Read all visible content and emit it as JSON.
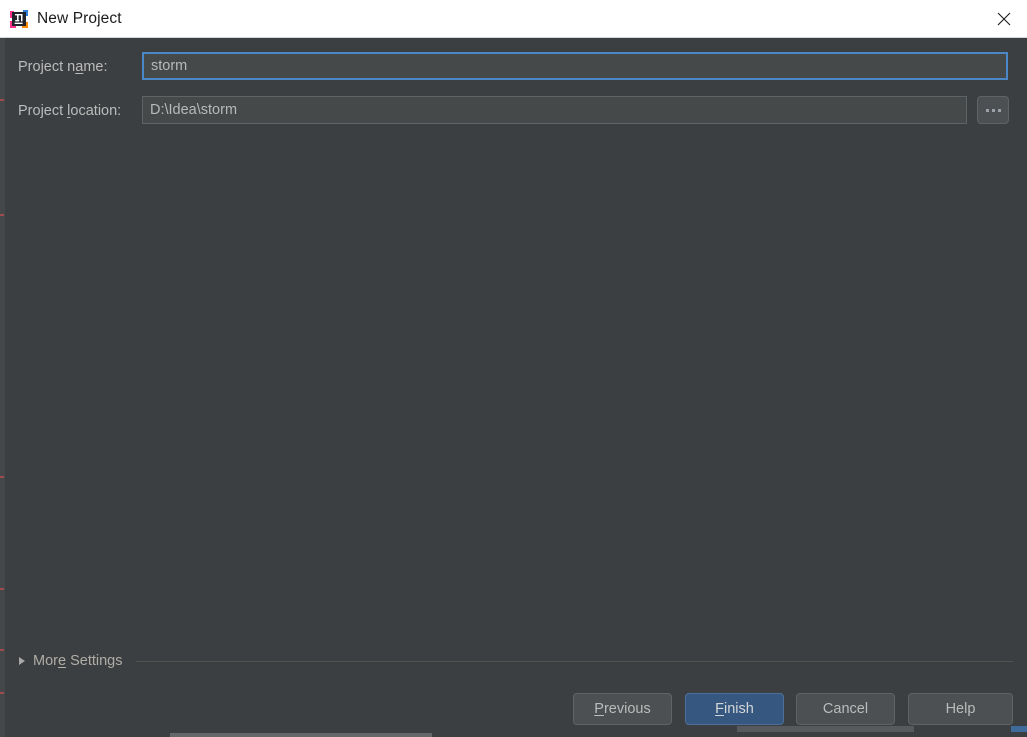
{
  "window": {
    "title": "New Project",
    "app_icon": "intellij-idea-logo-icon",
    "close_icon": "close-icon"
  },
  "form": {
    "project_name": {
      "label_before": "Project n",
      "label_mnemonic": "a",
      "label_after": "me:",
      "value": "storm",
      "placeholder": ""
    },
    "project_location": {
      "label_before": "Project ",
      "label_mnemonic": "l",
      "label_after": "ocation:",
      "value": "D:\\Idea\\storm",
      "placeholder": ""
    },
    "browse_button": {
      "label": "...",
      "icon": "ellipsis-icon"
    }
  },
  "more_settings": {
    "label_before": "Mor",
    "label_mnemonic": "e",
    "label_after": " Settings",
    "expanded": false,
    "disclosure_icon": "chevron-right-triangle-icon"
  },
  "footer": {
    "buttons": [
      {
        "before": "",
        "mnemonic": "P",
        "after": "revious",
        "name": "previous-button",
        "default": false
      },
      {
        "before": "",
        "mnemonic": "F",
        "after": "inish",
        "name": "finish-button",
        "default": true
      },
      {
        "before": "Cancel",
        "mnemonic": "",
        "after": "",
        "name": "cancel-button",
        "default": false
      },
      {
        "before": "Help",
        "mnemonic": "",
        "after": "",
        "name": "help-button",
        "default": false
      }
    ]
  },
  "colors": {
    "dialog_background": "#3c3f41",
    "titlebar_background": "#ffffff",
    "field_background": "#45494a",
    "focus_border": "#4a88c7",
    "default_button": "#365880",
    "text": "#bbbbbb"
  }
}
